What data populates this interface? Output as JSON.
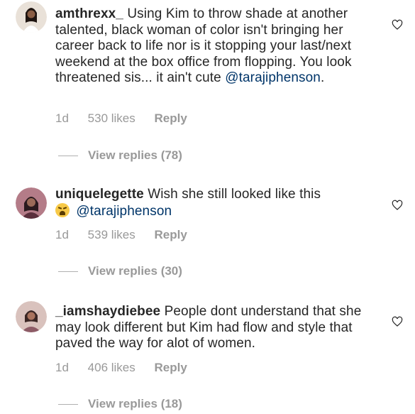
{
  "comments": [
    {
      "username": "amthrexx_",
      "text": "Using Kim to throw shade at another talented, black woman of color isn't bringing her career back to life nor is it stopping your last/next weekend at the box office from flopping. You look threatened sis... it ain't cute",
      "mention": "@tarajiphenson",
      "time": "1d",
      "likes": "530 likes",
      "reply_label": "Reply",
      "view_replies": "View replies (78)",
      "avatar_color": "#c9b7a8"
    },
    {
      "username": "uniquelegette",
      "text": "Wish she still looked like this",
      "emoji": "weary-face-emoji",
      "mention": "@tarajiphenson",
      "time": "1d",
      "likes": "539 likes",
      "reply_label": "Reply",
      "view_replies": "View replies (30)",
      "avatar_color": "#7a4a5a"
    },
    {
      "username": "_iamshaydiebee",
      "text": "People dont understand that she may look different but Kim had flow and style that paved the way for alot of women.",
      "time": "1d",
      "likes": "406 likes",
      "reply_label": "Reply",
      "view_replies": "View replies (18)",
      "avatar_color": "#b88a7a"
    }
  ],
  "colors": {
    "text": "#262626",
    "muted": "#999999",
    "mention": "#003569"
  }
}
